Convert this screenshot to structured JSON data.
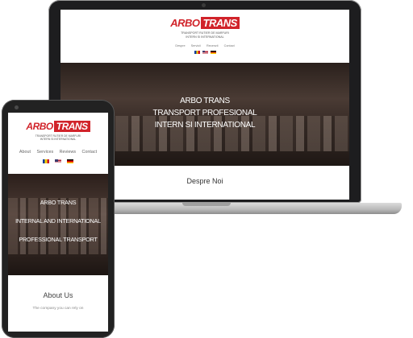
{
  "laptop": {
    "logo": {
      "text_a": "ARBO",
      "text_b": "TRANS"
    },
    "tagline": [
      "TRANSPORT RUTIER DE MARFURI",
      "INTERN SI INTERNATIONAL"
    ],
    "nav": [
      "Despre",
      "Servicii",
      "Recenzii",
      "Contact"
    ],
    "hero_lines": [
      "ARBO TRANS",
      "TRANSPORT PROFESIONAL",
      "INTERN SI INTERNATIONAL"
    ],
    "section_title": "Despre Noi"
  },
  "phone": {
    "logo": {
      "text_a": "ARBO",
      "text_b": "TRANS"
    },
    "tagline": [
      "TRANSPORT RUTIER DE MARFURI",
      "INTERN SI INTERNATIONAL"
    ],
    "nav": [
      "About",
      "Services",
      "Reviews",
      "Contact"
    ],
    "hero_lines": [
      "ARBO TRANS",
      "INTERNAL AND INTERNATIONAL",
      "PROFESSIONAL TRANSPORT"
    ],
    "section_title": "About Us",
    "section_sub": "The company you can rely on"
  },
  "flags": [
    "romania-flag",
    "usa-flag",
    "germany-flag"
  ],
  "colors": {
    "brand_red": "#d1232a",
    "device_frame": "#1d1d1f"
  }
}
